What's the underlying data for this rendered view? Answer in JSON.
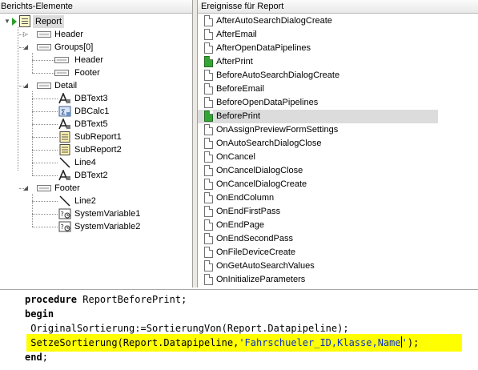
{
  "left_pane": {
    "header": "Berichts-Elemente",
    "tree": {
      "report": "Report",
      "header": "Header",
      "groups": "Groups[0]",
      "group_header": "Header",
      "group_footer": "Footer",
      "detail": "Detail",
      "detail_items": [
        "DBText3",
        "DBCalc1",
        "DBText5",
        "SubReport1",
        "SubReport2",
        "Line4",
        "DBText2"
      ],
      "footer": "Footer",
      "footer_items": [
        "Line2",
        "SystemVariable1",
        "SystemVariable2"
      ]
    }
  },
  "right_pane": {
    "header": "Ereignisse für Report",
    "events": [
      {
        "label": "AfterAutoSearchDialogCreate",
        "assigned": false,
        "selected": false
      },
      {
        "label": "AfterEmail",
        "assigned": false,
        "selected": false
      },
      {
        "label": "AfterOpenDataPipelines",
        "assigned": false,
        "selected": false
      },
      {
        "label": "AfterPrint",
        "assigned": true,
        "selected": false
      },
      {
        "label": "BeforeAutoSearchDialogCreate",
        "assigned": false,
        "selected": false
      },
      {
        "label": "BeforeEmail",
        "assigned": false,
        "selected": false
      },
      {
        "label": "BeforeOpenDataPipelines",
        "assigned": false,
        "selected": false
      },
      {
        "label": "BeforePrint",
        "assigned": true,
        "selected": true
      },
      {
        "label": "OnAssignPreviewFormSettings",
        "assigned": false,
        "selected": false
      },
      {
        "label": "OnAutoSearchDialogClose",
        "assigned": false,
        "selected": false
      },
      {
        "label": "OnCancel",
        "assigned": false,
        "selected": false
      },
      {
        "label": "OnCancelDialogClose",
        "assigned": false,
        "selected": false
      },
      {
        "label": "OnCancelDialogCreate",
        "assigned": false,
        "selected": false
      },
      {
        "label": "OnEndColumn",
        "assigned": false,
        "selected": false
      },
      {
        "label": "OnEndFirstPass",
        "assigned": false,
        "selected": false
      },
      {
        "label": "OnEndPage",
        "assigned": false,
        "selected": false
      },
      {
        "label": "OnEndSecondPass",
        "assigned": false,
        "selected": false
      },
      {
        "label": "OnFileDeviceCreate",
        "assigned": false,
        "selected": false
      },
      {
        "label": "OnGetAutoSearchValues",
        "assigned": false,
        "selected": false
      },
      {
        "label": "OnInitializeParameters",
        "assigned": false,
        "selected": false
      }
    ]
  },
  "code": {
    "line1_kw": "procedure",
    "line1_rest": " ReportBeforePrint;",
    "line2_kw": "begin",
    "line3": " OriginalSortierung:=SortierungVon(Report.Datapipeline);",
    "line4_pre": " SetzeSortierung(Report.Datapipeline,",
    "line4_str_a": "'Fahrschueler_ID,Klasse,Name",
    "line4_str_b": "'",
    "line4_post": ");",
    "line5_kw": "end",
    "line5_rest": ";"
  },
  "colors": {
    "highlight": "#ffff00",
    "string": "#0a32c8",
    "assigned_event_icon": "#35a535",
    "selected_row": "#dcdcdc"
  }
}
